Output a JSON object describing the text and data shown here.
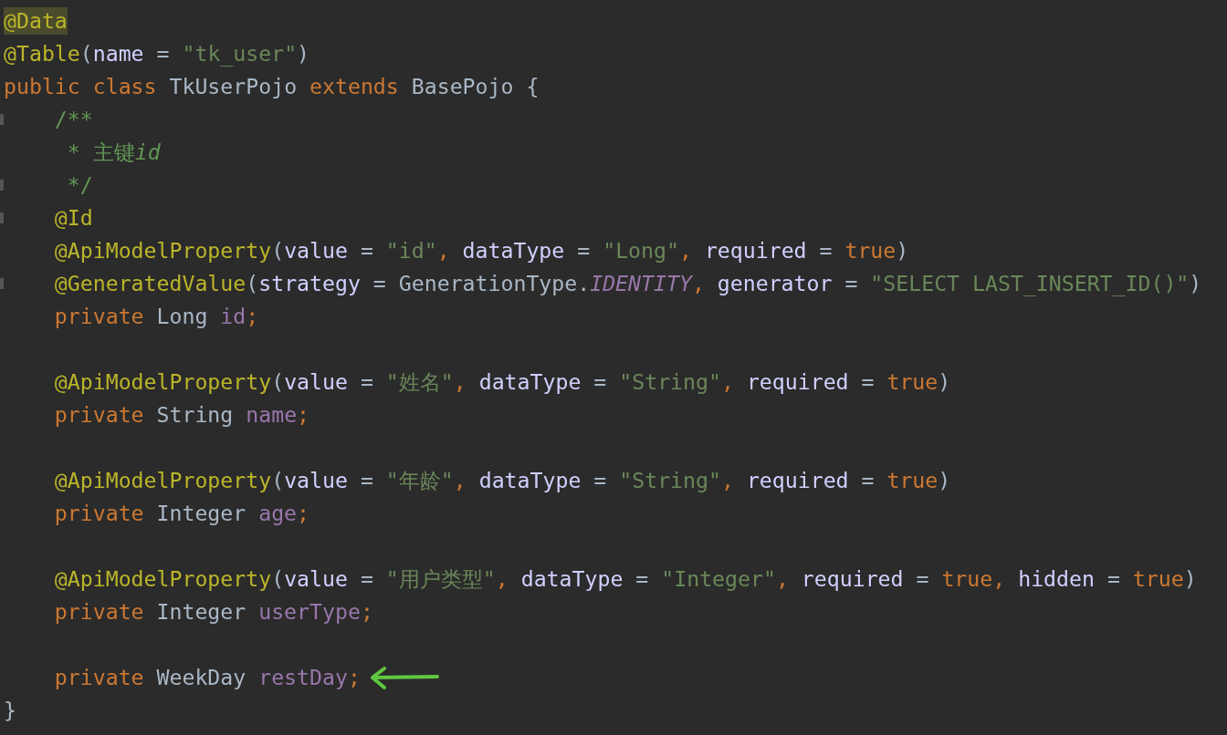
{
  "editor": {
    "lines": [
      {
        "highlighted": true,
        "fold_marker": false,
        "arrow": false,
        "tokens": [
          {
            "text": "@Data",
            "kind": "annotation"
          }
        ]
      },
      {
        "highlighted": false,
        "fold_marker": false,
        "arrow": false,
        "tokens": [
          {
            "text": "@Table",
            "kind": "annotation"
          },
          {
            "text": "(",
            "kind": "plain"
          },
          {
            "text": "name",
            "kind": "param"
          },
          {
            "text": " = ",
            "kind": "plain"
          },
          {
            "text": "\"tk_user\"",
            "kind": "string"
          },
          {
            "text": ")",
            "kind": "plain"
          }
        ]
      },
      {
        "highlighted": false,
        "fold_marker": false,
        "arrow": false,
        "tokens": [
          {
            "text": "public class",
            "kind": "keyword"
          },
          {
            "text": " TkUserPojo ",
            "kind": "plain"
          },
          {
            "text": "extends",
            "kind": "keyword"
          },
          {
            "text": " BasePojo {",
            "kind": "plain"
          }
        ]
      },
      {
        "highlighted": false,
        "fold_marker": true,
        "arrow": false,
        "tokens": [
          {
            "text": "    /**",
            "kind": "comment"
          }
        ]
      },
      {
        "highlighted": false,
        "fold_marker": false,
        "arrow": false,
        "tokens": [
          {
            "text": "     * 主键",
            "kind": "comment"
          },
          {
            "text": "id",
            "kind": "comment_italic"
          }
        ]
      },
      {
        "highlighted": false,
        "fold_marker": true,
        "arrow": false,
        "tokens": [
          {
            "text": "     */",
            "kind": "comment"
          }
        ]
      },
      {
        "highlighted": false,
        "fold_marker": true,
        "arrow": false,
        "tokens": [
          {
            "text": "    @Id",
            "kind": "annotation"
          }
        ]
      },
      {
        "highlighted": false,
        "fold_marker": false,
        "arrow": false,
        "tokens": [
          {
            "text": "    @ApiModelProperty",
            "kind": "annotation"
          },
          {
            "text": "(",
            "kind": "plain"
          },
          {
            "text": "value",
            "kind": "param"
          },
          {
            "text": " = ",
            "kind": "plain"
          },
          {
            "text": "\"id\"",
            "kind": "string"
          },
          {
            "text": ", ",
            "kind": "keyword"
          },
          {
            "text": "dataType",
            "kind": "param"
          },
          {
            "text": " = ",
            "kind": "plain"
          },
          {
            "text": "\"Long\"",
            "kind": "string"
          },
          {
            "text": ", ",
            "kind": "keyword"
          },
          {
            "text": "required",
            "kind": "param"
          },
          {
            "text": " = ",
            "kind": "plain"
          },
          {
            "text": "true",
            "kind": "keyword"
          },
          {
            "text": ")",
            "kind": "plain"
          }
        ]
      },
      {
        "highlighted": false,
        "fold_marker": true,
        "arrow": false,
        "tokens": [
          {
            "text": "    @GeneratedValue",
            "kind": "annotation"
          },
          {
            "text": "(",
            "kind": "plain"
          },
          {
            "text": "strategy",
            "kind": "param"
          },
          {
            "text": " = GenerationType.",
            "kind": "plain"
          },
          {
            "text": "IDENTITY",
            "kind": "constant"
          },
          {
            "text": ", ",
            "kind": "keyword"
          },
          {
            "text": "generator",
            "kind": "param"
          },
          {
            "text": " = ",
            "kind": "plain"
          },
          {
            "text": "\"SELECT LAST_INSERT_ID()\"",
            "kind": "string"
          },
          {
            "text": ")",
            "kind": "plain"
          }
        ]
      },
      {
        "highlighted": false,
        "fold_marker": false,
        "arrow": false,
        "tokens": [
          {
            "text": "    private",
            "kind": "keyword"
          },
          {
            "text": " Long ",
            "kind": "plain"
          },
          {
            "text": "id",
            "kind": "field"
          },
          {
            "text": ";",
            "kind": "keyword"
          }
        ]
      },
      {
        "fold_marker": false,
        "arrow": false
      },
      {
        "highlighted": false,
        "fold_marker": false,
        "arrow": false,
        "tokens": [
          {
            "text": "    @ApiModelProperty",
            "kind": "annotation"
          },
          {
            "text": "(",
            "kind": "plain"
          },
          {
            "text": "value",
            "kind": "param"
          },
          {
            "text": " = ",
            "kind": "plain"
          },
          {
            "text": "\"姓名\"",
            "kind": "string"
          },
          {
            "text": ", ",
            "kind": "keyword"
          },
          {
            "text": "dataType",
            "kind": "param"
          },
          {
            "text": " = ",
            "kind": "plain"
          },
          {
            "text": "\"String\"",
            "kind": "string"
          },
          {
            "text": ", ",
            "kind": "keyword"
          },
          {
            "text": "required",
            "kind": "param"
          },
          {
            "text": " = ",
            "kind": "plain"
          },
          {
            "text": "true",
            "kind": "keyword"
          },
          {
            "text": ")",
            "kind": "plain"
          }
        ]
      },
      {
        "highlighted": false,
        "fold_marker": false,
        "arrow": false,
        "tokens": [
          {
            "text": "    private",
            "kind": "keyword"
          },
          {
            "text": " String ",
            "kind": "plain"
          },
          {
            "text": "name",
            "kind": "field"
          },
          {
            "text": ";",
            "kind": "keyword"
          }
        ]
      },
      {
        "fold_marker": false,
        "arrow": false
      },
      {
        "highlighted": false,
        "fold_marker": false,
        "arrow": false,
        "tokens": [
          {
            "text": "    @ApiModelProperty",
            "kind": "annotation"
          },
          {
            "text": "(",
            "kind": "plain"
          },
          {
            "text": "value",
            "kind": "param"
          },
          {
            "text": " = ",
            "kind": "plain"
          },
          {
            "text": "\"年龄\"",
            "kind": "string"
          },
          {
            "text": ", ",
            "kind": "keyword"
          },
          {
            "text": "dataType",
            "kind": "param"
          },
          {
            "text": " = ",
            "kind": "plain"
          },
          {
            "text": "\"String\"",
            "kind": "string"
          },
          {
            "text": ", ",
            "kind": "keyword"
          },
          {
            "text": "required",
            "kind": "param"
          },
          {
            "text": " = ",
            "kind": "plain"
          },
          {
            "text": "true",
            "kind": "keyword"
          },
          {
            "text": ")",
            "kind": "plain"
          }
        ]
      },
      {
        "highlighted": false,
        "fold_marker": false,
        "arrow": false,
        "tokens": [
          {
            "text": "    private",
            "kind": "keyword"
          },
          {
            "text": " Integer ",
            "kind": "plain"
          },
          {
            "text": "age",
            "kind": "field"
          },
          {
            "text": ";",
            "kind": "keyword"
          }
        ]
      },
      {
        "fold_marker": false,
        "arrow": false
      },
      {
        "highlighted": false,
        "fold_marker": false,
        "arrow": false,
        "tokens": [
          {
            "text": "    @ApiModelProperty",
            "kind": "annotation"
          },
          {
            "text": "(",
            "kind": "plain"
          },
          {
            "text": "value",
            "kind": "param"
          },
          {
            "text": " = ",
            "kind": "plain"
          },
          {
            "text": "\"用户类型\"",
            "kind": "string"
          },
          {
            "text": ", ",
            "kind": "keyword"
          },
          {
            "text": "dataType",
            "kind": "param"
          },
          {
            "text": " = ",
            "kind": "plain"
          },
          {
            "text": "\"Integer\"",
            "kind": "string"
          },
          {
            "text": ", ",
            "kind": "keyword"
          },
          {
            "text": "required",
            "kind": "param"
          },
          {
            "text": " = ",
            "kind": "plain"
          },
          {
            "text": "true",
            "kind": "keyword"
          },
          {
            "text": ", ",
            "kind": "keyword"
          },
          {
            "text": "hidden",
            "kind": "param"
          },
          {
            "text": " = ",
            "kind": "plain"
          },
          {
            "text": "true",
            "kind": "keyword"
          },
          {
            "text": ")",
            "kind": "plain"
          }
        ]
      },
      {
        "highlighted": false,
        "fold_marker": false,
        "arrow": false,
        "tokens": [
          {
            "text": "    private",
            "kind": "keyword"
          },
          {
            "text": " Integer ",
            "kind": "plain"
          },
          {
            "text": "userType",
            "kind": "field"
          },
          {
            "text": ";",
            "kind": "keyword"
          }
        ]
      },
      {
        "fold_marker": false,
        "arrow": false
      },
      {
        "highlighted": false,
        "fold_marker": false,
        "arrow": true,
        "tokens": [
          {
            "text": "    private",
            "kind": "keyword"
          },
          {
            "text": " WeekDay ",
            "kind": "plain"
          },
          {
            "text": "restDay",
            "kind": "field"
          },
          {
            "text": ";",
            "kind": "keyword"
          }
        ]
      },
      {
        "highlighted": false,
        "fold_marker": false,
        "arrow": false,
        "tokens": [
          {
            "text": "}",
            "kind": "plain"
          }
        ]
      }
    ]
  }
}
